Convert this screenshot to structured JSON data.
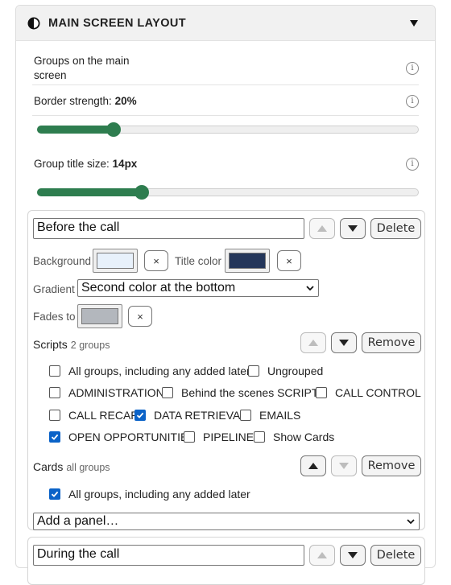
{
  "panel": {
    "title": "MAIN SCREEN LAYOUT",
    "collapse_icon": "triangle-down"
  },
  "settings": {
    "groups_label_line1": "Groups on the main",
    "groups_label_line2": "screen",
    "border_label": "Border strength: ",
    "border_value": "20%",
    "border_fraction": 0.2,
    "title_size_label": "Group title size: ",
    "title_size_value": "14px",
    "title_size_fraction": 0.275,
    "info_glyph": "i"
  },
  "group1": {
    "name": "Before the call",
    "delete_label": "Delete",
    "background_label": "Background",
    "background_color": "#e8f1fb",
    "title_color_label": "Title color",
    "title_color": "#24365a",
    "clear_glyph": "×",
    "gradient_label": "Gradient",
    "gradient_value": "Second color at the bottom",
    "fades_label": "Fades to",
    "fades_color": "#b3b7bd",
    "scripts_label": "Scripts",
    "scripts_sub": "2 groups",
    "remove_label": "Remove",
    "scripts_items": [
      {
        "label": "All groups, including any added later",
        "checked": false
      },
      {
        "label": "Ungrouped",
        "checked": false
      },
      {
        "label": "ADMINISTRATION",
        "checked": false
      },
      {
        "label": "Behind the scenes SCRIPTS",
        "checked": false
      },
      {
        "label": "CALL CONTROL",
        "checked": false
      },
      {
        "label": "CALL RECAP",
        "checked": false
      },
      {
        "label": "DATA RETRIEVAL",
        "checked": true
      },
      {
        "label": "EMAILS",
        "checked": false
      },
      {
        "label": "OPEN OPPORTUNITIES",
        "checked": true
      },
      {
        "label": "PIPELINE",
        "checked": false
      },
      {
        "label": "Show Cards",
        "checked": false
      }
    ],
    "cards_label": "Cards",
    "cards_sub": "all groups",
    "cards_items": [
      {
        "label": "All groups, including any added later",
        "checked": true
      }
    ],
    "add_panel_value": "Add a panel…"
  },
  "group2": {
    "name": "During the call",
    "delete_label": "Delete"
  }
}
